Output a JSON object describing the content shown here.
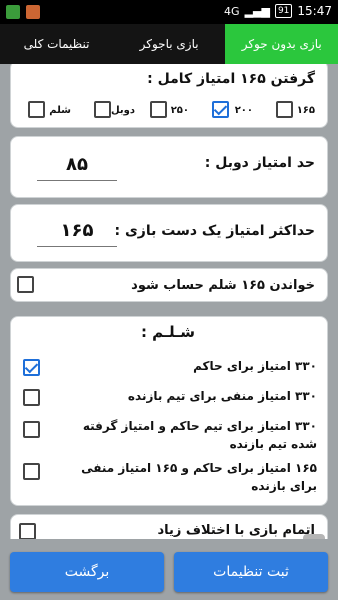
{
  "status_bar": {
    "network": "4G",
    "battery": "91",
    "time": "15:47"
  },
  "tabs": [
    {
      "label": "بازی بدون جوکر",
      "active": true
    },
    {
      "label": "بازی باجوکر",
      "active": false
    },
    {
      "label": "تنظیمات کلی",
      "active": false
    }
  ],
  "full_score": {
    "title": "گرفتن ۱۶۵ امتیاز کامل :",
    "options": [
      {
        "label": "۱۶۵",
        "checked": false
      },
      {
        "label": "۲۰۰",
        "checked": true
      },
      {
        "label": "۲۵۰",
        "checked": false
      },
      {
        "label": "دوبل",
        "checked": false
      },
      {
        "label": "شلم",
        "checked": false
      }
    ]
  },
  "double_limit": {
    "title": "حد امتیاز دوبل :",
    "value": "۸۵"
  },
  "max_hand": {
    "title": "حداکثر امتیاز یک دست بازی :",
    "value": "۱۶۵"
  },
  "read_165": {
    "title": "خواندن ۱۶۵ شلم حساب شود",
    "checked": false
  },
  "shelem": {
    "heading": "شـلـم :",
    "items": [
      {
        "text": "۳۳۰ امتیاز برای حاکم",
        "checked": true
      },
      {
        "text": "۳۳۰ امتیاز منفی برای تیم بازنده",
        "checked": false
      },
      {
        "text": "۳۳۰ امتیاز برای تیم حاکم و امتیاز گرفته شده تیم بازنده",
        "checked": false
      },
      {
        "text": "۱۶۵ امتیاز برای حاکم و ۱۶۵ امتیاز منفی برای بازنده",
        "checked": false
      }
    ]
  },
  "end_game": {
    "title": "اتمام بازی با اختلاف زیاد",
    "checked": false
  },
  "buttons": {
    "back": "برگشت",
    "save": "ثبت تنظیمات"
  },
  "colors": {
    "active_tab": "#2bc73d",
    "button": "#2f7de0",
    "check": "#1e6fd9"
  }
}
